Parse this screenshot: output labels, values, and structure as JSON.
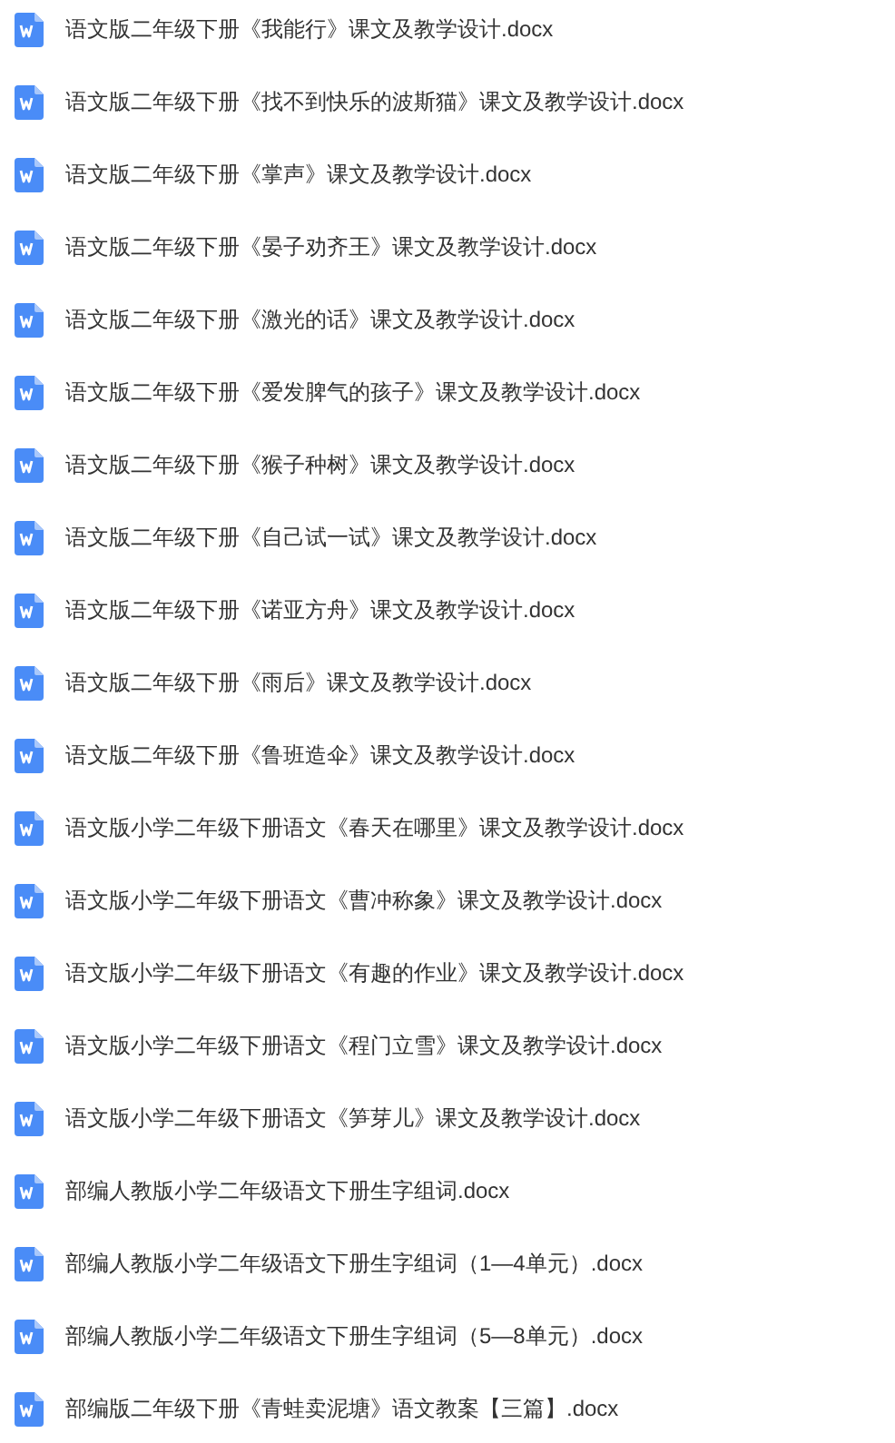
{
  "files": [
    {
      "name": "语文版二年级下册《我能行》课文及教学设计.docx"
    },
    {
      "name": "语文版二年级下册《找不到快乐的波斯猫》课文及教学设计.docx"
    },
    {
      "name": "语文版二年级下册《掌声》课文及教学设计.docx"
    },
    {
      "name": "语文版二年级下册《晏子劝齐王》课文及教学设计.docx"
    },
    {
      "name": "语文版二年级下册《激光的话》课文及教学设计.docx"
    },
    {
      "name": "语文版二年级下册《爱发脾气的孩子》课文及教学设计.docx"
    },
    {
      "name": "语文版二年级下册《猴子种树》课文及教学设计.docx"
    },
    {
      "name": "语文版二年级下册《自己试一试》课文及教学设计.docx"
    },
    {
      "name": "语文版二年级下册《诺亚方舟》课文及教学设计.docx"
    },
    {
      "name": "语文版二年级下册《雨后》课文及教学设计.docx"
    },
    {
      "name": "语文版二年级下册《鲁班造伞》课文及教学设计.docx"
    },
    {
      "name": "语文版小学二年级下册语文《春天在哪里》课文及教学设计.docx"
    },
    {
      "name": "语文版小学二年级下册语文《曹冲称象》课文及教学设计.docx"
    },
    {
      "name": "语文版小学二年级下册语文《有趣的作业》课文及教学设计.docx"
    },
    {
      "name": "语文版小学二年级下册语文《程门立雪》课文及教学设计.docx"
    },
    {
      "name": "语文版小学二年级下册语文《笋芽儿》课文及教学设计.docx"
    },
    {
      "name": "部编人教版小学二年级语文下册生字组词.docx"
    },
    {
      "name": "部编人教版小学二年级语文下册生字组词（1—4单元）.docx"
    },
    {
      "name": "部编人教版小学二年级语文下册生字组词（5—8单元）.docx"
    },
    {
      "name": "部编版二年级下册《青蛙卖泥塘》语文教案【三篇】.docx"
    }
  ]
}
